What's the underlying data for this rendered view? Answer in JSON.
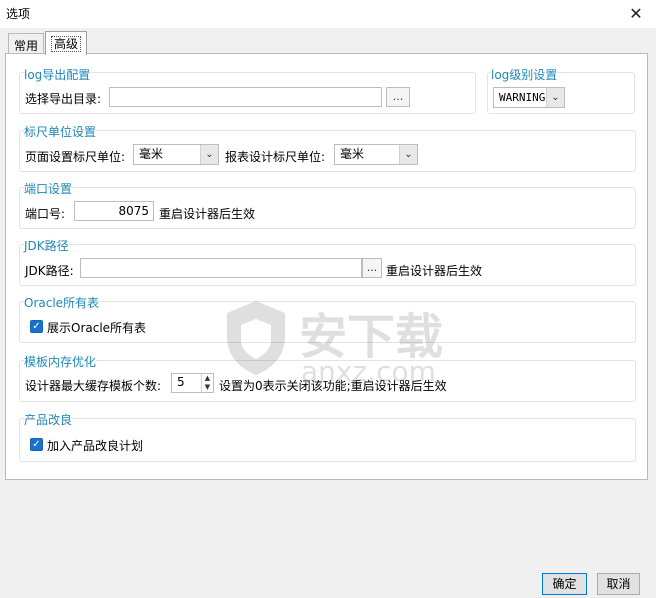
{
  "window": {
    "title": "选项",
    "close_glyph": "✕"
  },
  "tabs": [
    {
      "label": "常用"
    },
    {
      "label": "高级"
    }
  ],
  "log_export": {
    "title": "log导出配置",
    "dir_label": "选择导出目录:",
    "dir_value": "",
    "browse_label": "..."
  },
  "log_level": {
    "title": "log级别设置",
    "value": "WARNING"
  },
  "ruler": {
    "title": "标尺单位设置",
    "page_label": "页面设置标尺单位:",
    "page_value": "毫米",
    "report_label": "报表设计标尺单位:",
    "report_value": "毫米"
  },
  "port": {
    "title": "端口设置",
    "label": "端口号:",
    "value": "8075",
    "hint": "重启设计器后生效"
  },
  "jdk": {
    "title": "JDK路径",
    "label": "JDK路径:",
    "value": "",
    "browse_label": "...",
    "hint": "重启设计器后生效"
  },
  "oracle": {
    "title": "Oracle所有表",
    "checkbox_label": "展示Oracle所有表",
    "checked": true
  },
  "template_memory": {
    "title": "模板内存优化",
    "label": "设计器最大缓存模板个数:",
    "value": "5",
    "hint": "设置为0表示关闭该功能;重启设计器后生效"
  },
  "improvement": {
    "title": "产品改良",
    "checkbox_label": "加入产品改良计划",
    "checked": true
  },
  "watermark": {
    "text": "安下载",
    "sub": "anxz.com"
  },
  "footer": {
    "ok_label": "确定",
    "cancel_label": "取消"
  },
  "colors": {
    "section_title": "#1f87b8",
    "checkbox": "#1a73c8"
  }
}
